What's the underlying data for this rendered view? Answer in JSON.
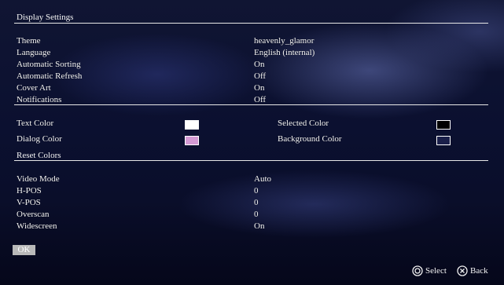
{
  "sections": {
    "display": "Display Settings",
    "reset": "Reset Colors"
  },
  "settings": [
    {
      "label": "Theme",
      "value": "heavenly_glamor"
    },
    {
      "label": "Language",
      "value": "English (internal)"
    },
    {
      "label": "Automatic Sorting",
      "value": "On"
    },
    {
      "label": "Automatic Refresh",
      "value": "Off"
    },
    {
      "label": "Cover Art",
      "value": "On"
    },
    {
      "label": "Notifications",
      "value": "Off"
    }
  ],
  "colors": {
    "text": {
      "label": "Text Color",
      "swatch": "#ffffff"
    },
    "selected": {
      "label": "Selected Color",
      "swatch": "#000000"
    },
    "dialog": {
      "label": "Dialog Color",
      "swatch": "#d49ad4"
    },
    "background": {
      "label": "Background Color",
      "swatch": "#1a1f4a"
    }
  },
  "video": [
    {
      "label": "Video Mode",
      "value": "Auto"
    },
    {
      "label": "H-POS",
      "value": "0"
    },
    {
      "label": "V-POS",
      "value": "0"
    },
    {
      "label": "Overscan",
      "value": "0"
    },
    {
      "label": "Widescreen",
      "value": "On"
    }
  ],
  "footer": {
    "ok_label": "OK",
    "select_label": "Select",
    "back_label": "Back",
    "select_icon": "circle-button-icon",
    "back_icon": "cross-button-icon"
  }
}
